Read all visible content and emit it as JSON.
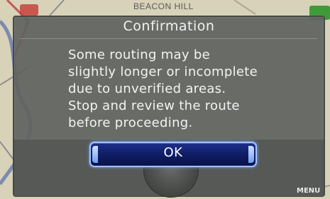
{
  "map": {
    "street_label": "BEACON HILL",
    "menu_label": "MENU"
  },
  "dialog": {
    "title": "Confirmation",
    "message": "Some routing may be\nslightly longer or incomplete\ndue to unverified areas.\nStop and review the route\nbefore proceeding.",
    "ok_label": "OK"
  },
  "colors": {
    "dialog_bg": "#606260",
    "button_bg": "#0f1c62",
    "button_border": "#9fc3ff",
    "map_land": "#d8d2b8",
    "map_green": "#3f9a3a"
  }
}
